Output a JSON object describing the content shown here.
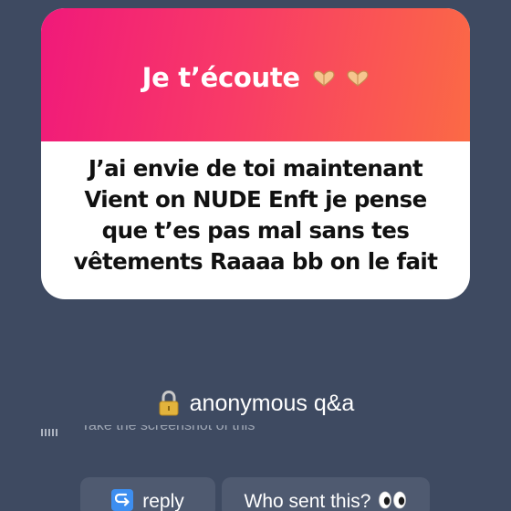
{
  "card": {
    "title": "Je t’écoute",
    "title_icon": "heart-hands-icon",
    "question_lines": [
      "J’ai envie de toi maintenant",
      "Vient on NUDE Enft je pense",
      "que t’es pas mal sans tes",
      "vêtements Raaaa bb on le fait"
    ]
  },
  "label": {
    "icon": "lock-icon",
    "text": "anonymous q&a"
  },
  "hint": {
    "text": "Take the screenshot of this"
  },
  "actions": {
    "reply_icon": "reply-arrow-icon",
    "reply_label": "reply",
    "who_label": "Who sent this?",
    "who_icon": "eyes-icon"
  },
  "colors": {
    "background": "#3e4a61",
    "gradient_start": "#f0197a",
    "gradient_end": "#fb6a45",
    "button_bg": "#4f5a70",
    "reply_icon_bg": "#3d8ef0"
  }
}
